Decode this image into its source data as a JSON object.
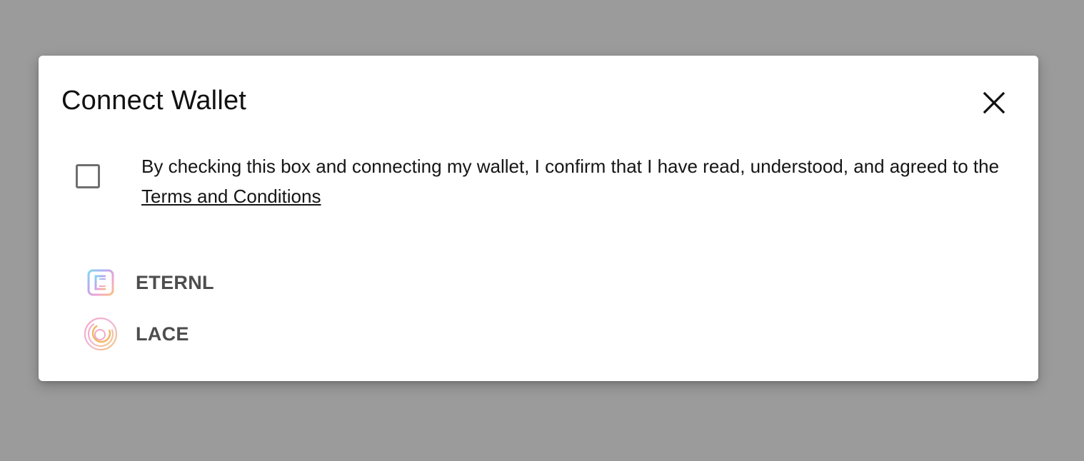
{
  "dialog": {
    "title": "Connect Wallet",
    "close_icon": "close-icon"
  },
  "consent": {
    "text": "By checking this box and connecting my wallet, I confirm that I have read, understood, and agreed to the ",
    "link_text": "Terms and Conditions",
    "checked": false
  },
  "wallets": [
    {
      "label": "ETERNL",
      "icon": "eternl-logo-icon"
    },
    {
      "label": "LACE",
      "icon": "lace-logo-icon"
    }
  ],
  "colors": {
    "backdrop": "#9b9b9b",
    "dialog_bg": "#ffffff",
    "title": "#111111",
    "wallet_label": "#4d4d4d",
    "checkbox_border": "#6f6f6f"
  }
}
